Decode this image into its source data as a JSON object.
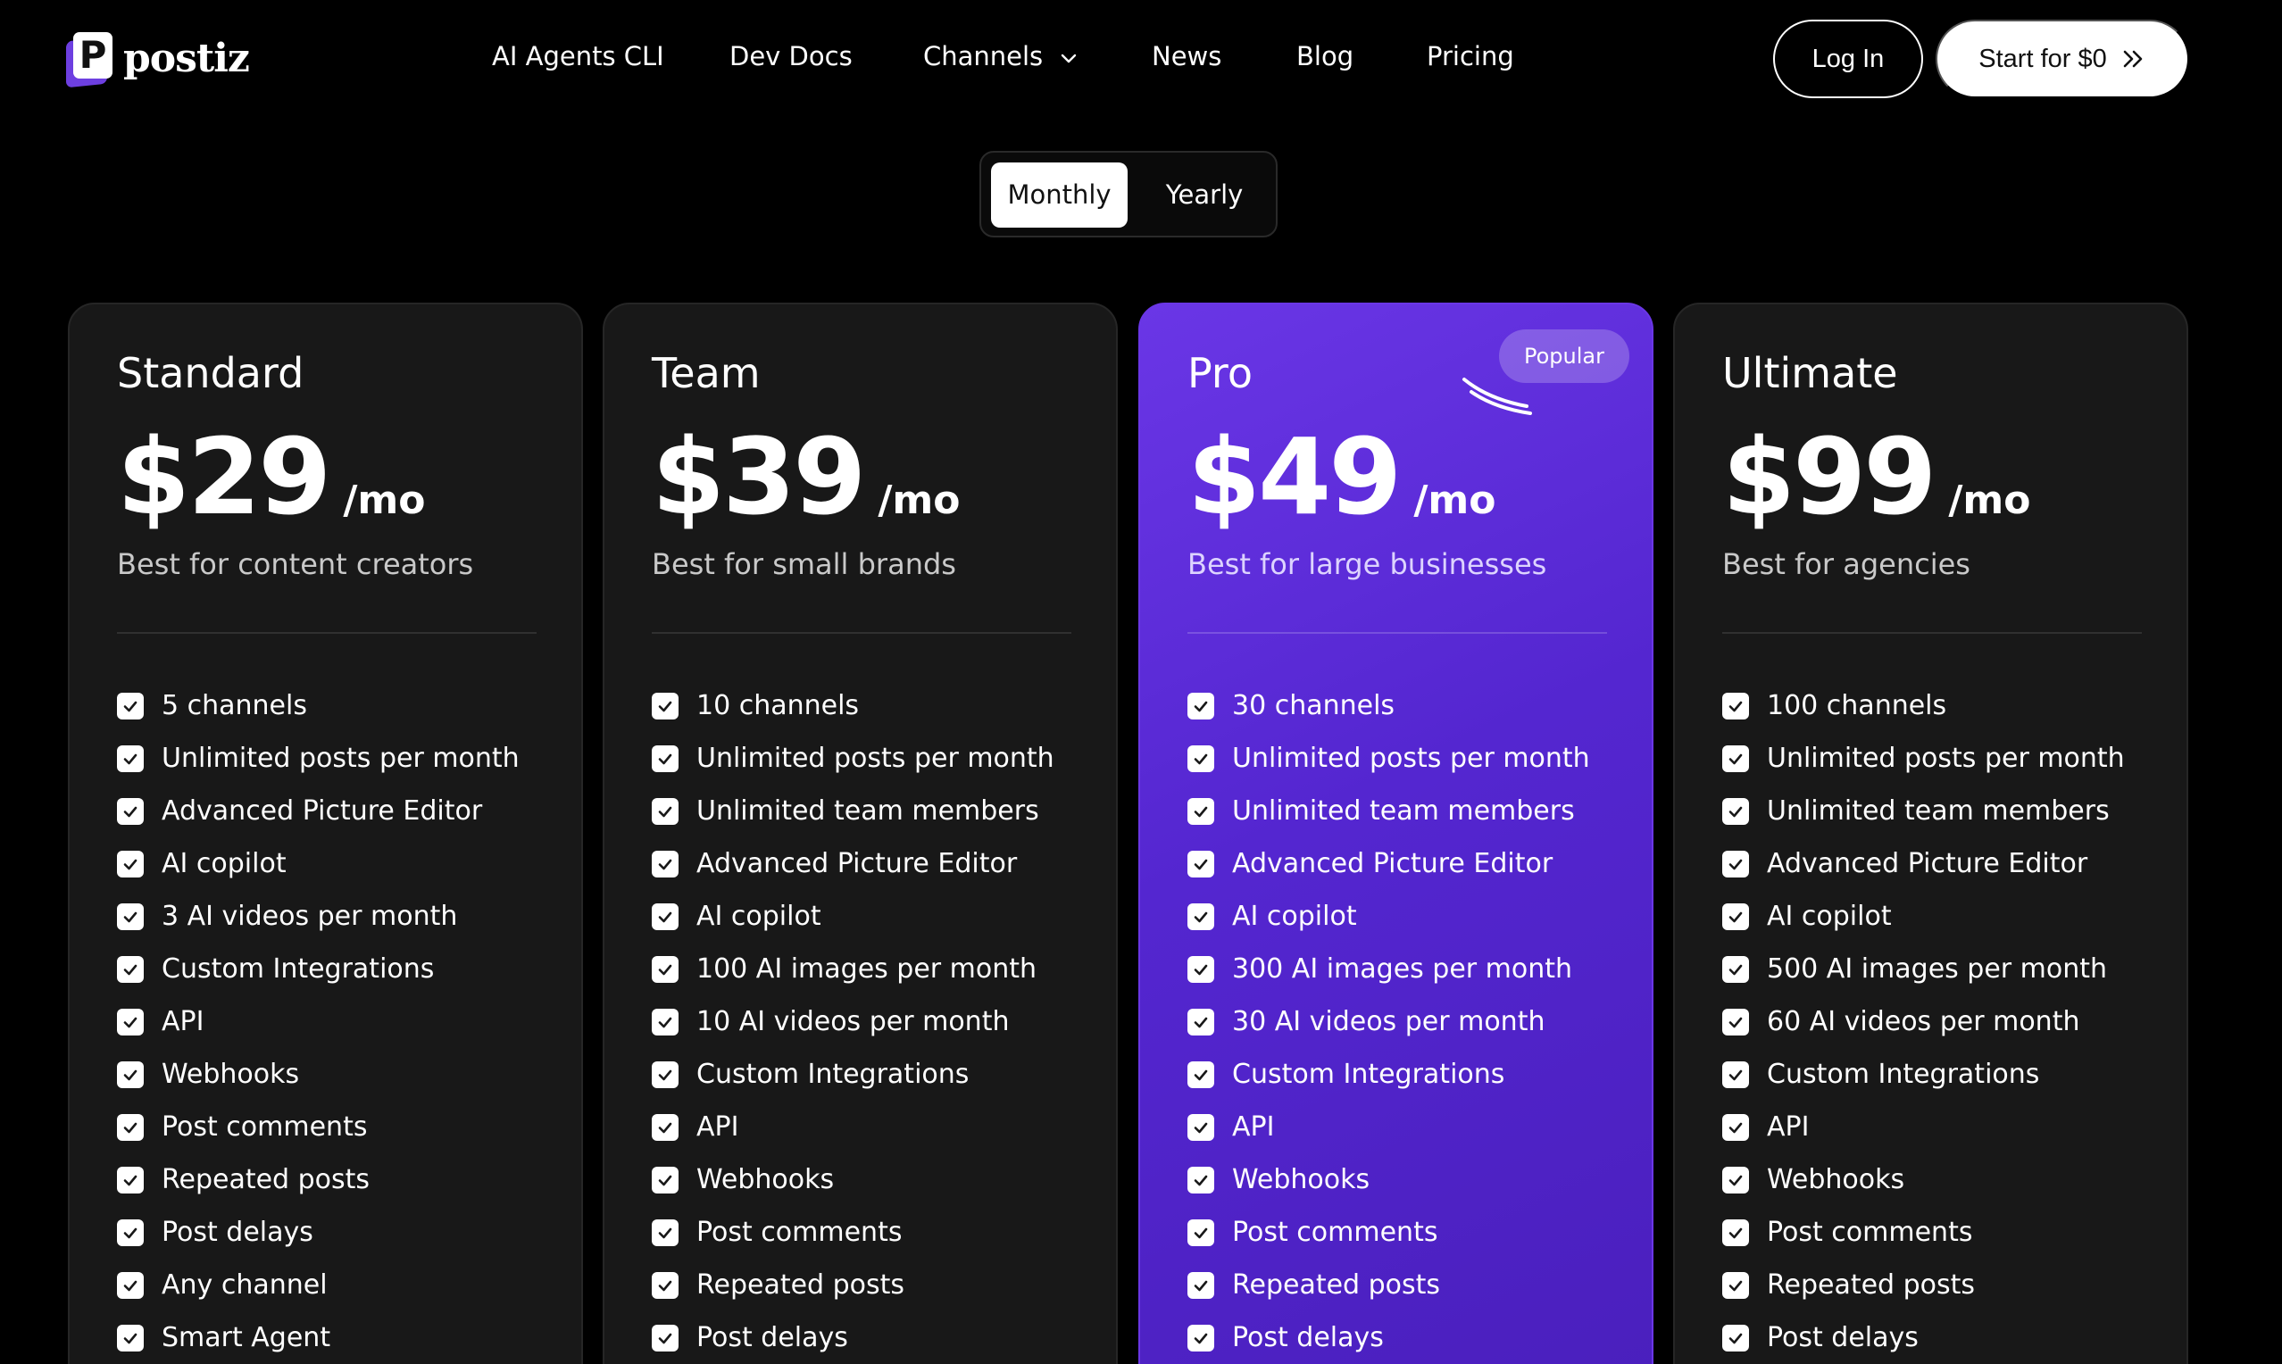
{
  "brand": {
    "name": "postiz",
    "logo_letter": "P"
  },
  "nav": {
    "items": [
      "AI Agents CLI",
      "Dev Docs",
      "Channels",
      "News",
      "Blog",
      "Pricing"
    ],
    "login_label": "Log In",
    "start_label": "Start for $0"
  },
  "billing": {
    "monthly": "Monthly",
    "yearly": "Yearly",
    "selected": "Monthly"
  },
  "plans": [
    {
      "name": "Standard",
      "price": "$29",
      "period": "/mo",
      "tagline": "Best for content creators",
      "features": [
        "5 channels",
        "Unlimited posts per month",
        "Advanced Picture Editor",
        "AI copilot",
        "3 AI videos per month",
        "Custom Integrations",
        "API",
        "Webhooks",
        "Post comments",
        "Repeated posts",
        "Post delays",
        "Any channel",
        "Smart Agent"
      ]
    },
    {
      "name": "Team",
      "price": "$39",
      "period": "/mo",
      "tagline": "Best for small brands",
      "features": [
        "10 channels",
        "Unlimited posts per month",
        "Unlimited team members",
        "Advanced Picture Editor",
        "AI copilot",
        "100 AI images per month",
        "10 AI videos per month",
        "Custom Integrations",
        "API",
        "Webhooks",
        "Post comments",
        "Repeated posts",
        "Post delays"
      ]
    },
    {
      "name": "Pro",
      "price": "$49",
      "period": "/mo",
      "tagline": "Best for large businesses",
      "badge": "Popular",
      "features": [
        "30 channels",
        "Unlimited posts per month",
        "Unlimited team members",
        "Advanced Picture Editor",
        "AI copilot",
        "300 AI images per month",
        "30 AI videos per month",
        "Custom Integrations",
        "API",
        "Webhooks",
        "Post comments",
        "Repeated posts",
        "Post delays"
      ]
    },
    {
      "name": "Ultimate",
      "price": "$99",
      "period": "/mo",
      "tagline": "Best for agencies",
      "features": [
        "100 channels",
        "Unlimited posts per month",
        "Unlimited team members",
        "Advanced Picture Editor",
        "AI copilot",
        "500 AI images per month",
        "60 AI videos per month",
        "Custom Integrations",
        "API",
        "Webhooks",
        "Post comments",
        "Repeated posts",
        "Post delays"
      ]
    }
  ],
  "colors": {
    "background": "#000000",
    "card": "#181818",
    "accent": "#5a2ad6",
    "check": "#ffffff"
  },
  "icons": {
    "check": "check-icon",
    "channels_menu": "chevron-down-icon",
    "start_arrow": "double-chevron-right-icon"
  }
}
